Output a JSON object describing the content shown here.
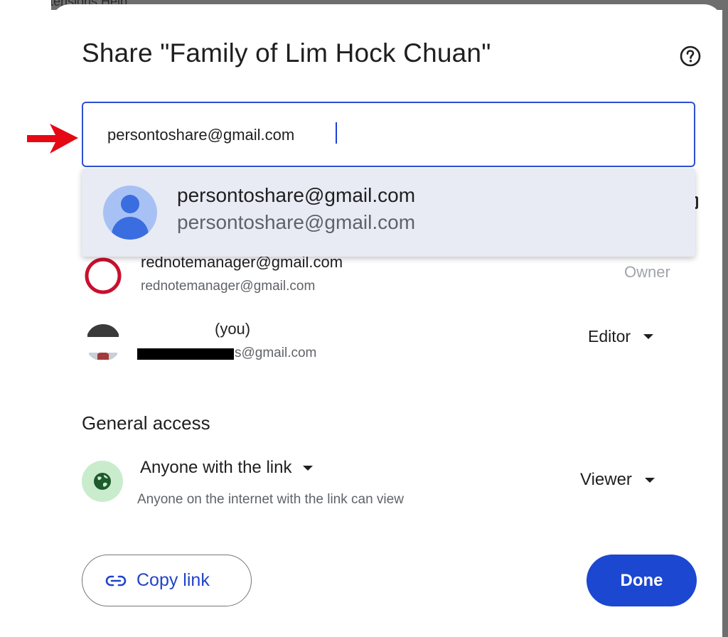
{
  "background": {
    "menu_remnant": "tensions  Help"
  },
  "dialog": {
    "title": "Share \"Family of Lim Hock Chuan\"",
    "help_icon": "help-circle-icon"
  },
  "share_input": {
    "value": "persontoshare@gmail.com",
    "border_color": "#2d4fd3"
  },
  "suggestion": {
    "name": "persontoshare@gmail.com",
    "email": "persontoshare@gmail.com",
    "avatar_icon": "person-avatar-icon"
  },
  "people": [
    {
      "name": "rednotemanager@gmail.com",
      "email": "rednotemanager@gmail.com",
      "role": "Owner",
      "avatar_icon": "red-note-logo-icon"
    },
    {
      "name": "(you)",
      "email": "s@gmail.com",
      "role": "Editor",
      "avatar_icon": "user-photo-avatar"
    }
  ],
  "general_access": {
    "title": "General access",
    "mode": "Anyone with the link",
    "description": "Anyone on the internet with the link can view",
    "role": "Viewer",
    "icon": "globe-icon",
    "icon_bg": "#c9eccd"
  },
  "actions": {
    "copy_link": "Copy link",
    "copy_icon": "link-icon",
    "done": "Done"
  },
  "colors": {
    "primary": "#1c47d1",
    "accent_link": "#2044c9",
    "annotation_arrow": "#e50914"
  }
}
